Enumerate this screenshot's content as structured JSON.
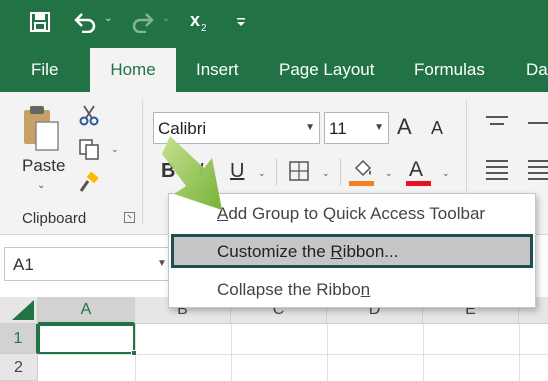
{
  "quick_access": {
    "save_icon": "save-icon",
    "undo_icon": "undo-icon",
    "redo_icon": "redo-icon",
    "subscript_label": "x",
    "subscript_suffix": "2",
    "customize_icon": "customize-qat-icon"
  },
  "tabs": [
    {
      "label": "File"
    },
    {
      "label": "Home",
      "active": true
    },
    {
      "label": "Insert"
    },
    {
      "label": "Page Layout"
    },
    {
      "label": "Formulas"
    },
    {
      "label": "Da"
    }
  ],
  "ribbon": {
    "clipboard": {
      "paste_label": "Paste",
      "group_label": "Clipboard"
    },
    "font": {
      "font_name": "Calibri",
      "font_size": "11",
      "bold": "B",
      "italic": "I",
      "underline": "U",
      "grow": "A",
      "shrink": "A",
      "font_color_letter": "A",
      "font_color": "#e81123",
      "fill_color": "#f4811f"
    }
  },
  "name_box": {
    "value": "A1"
  },
  "grid": {
    "columns": [
      "A",
      "B",
      "C",
      "D",
      "E"
    ],
    "rows": [
      "1",
      "2"
    ],
    "active_cell": "A1",
    "accent": "#217346"
  },
  "context_menu": {
    "items": [
      {
        "pre": "",
        "mnemonic": "A",
        "post": "dd Group to Quick Access Toolbar"
      },
      {
        "pre": "Customize the ",
        "mnemonic": "R",
        "post": "ibbon...",
        "highlighted": true
      },
      {
        "pre": "Collapse the Ribbo",
        "mnemonic": "n",
        "post": ""
      }
    ]
  },
  "colors": {
    "brand_green": "#217346",
    "ribbon_bg": "#f3f3f3",
    "menu_hover": "#c6c6c6",
    "pointer_arrow": "#8dc63f"
  }
}
